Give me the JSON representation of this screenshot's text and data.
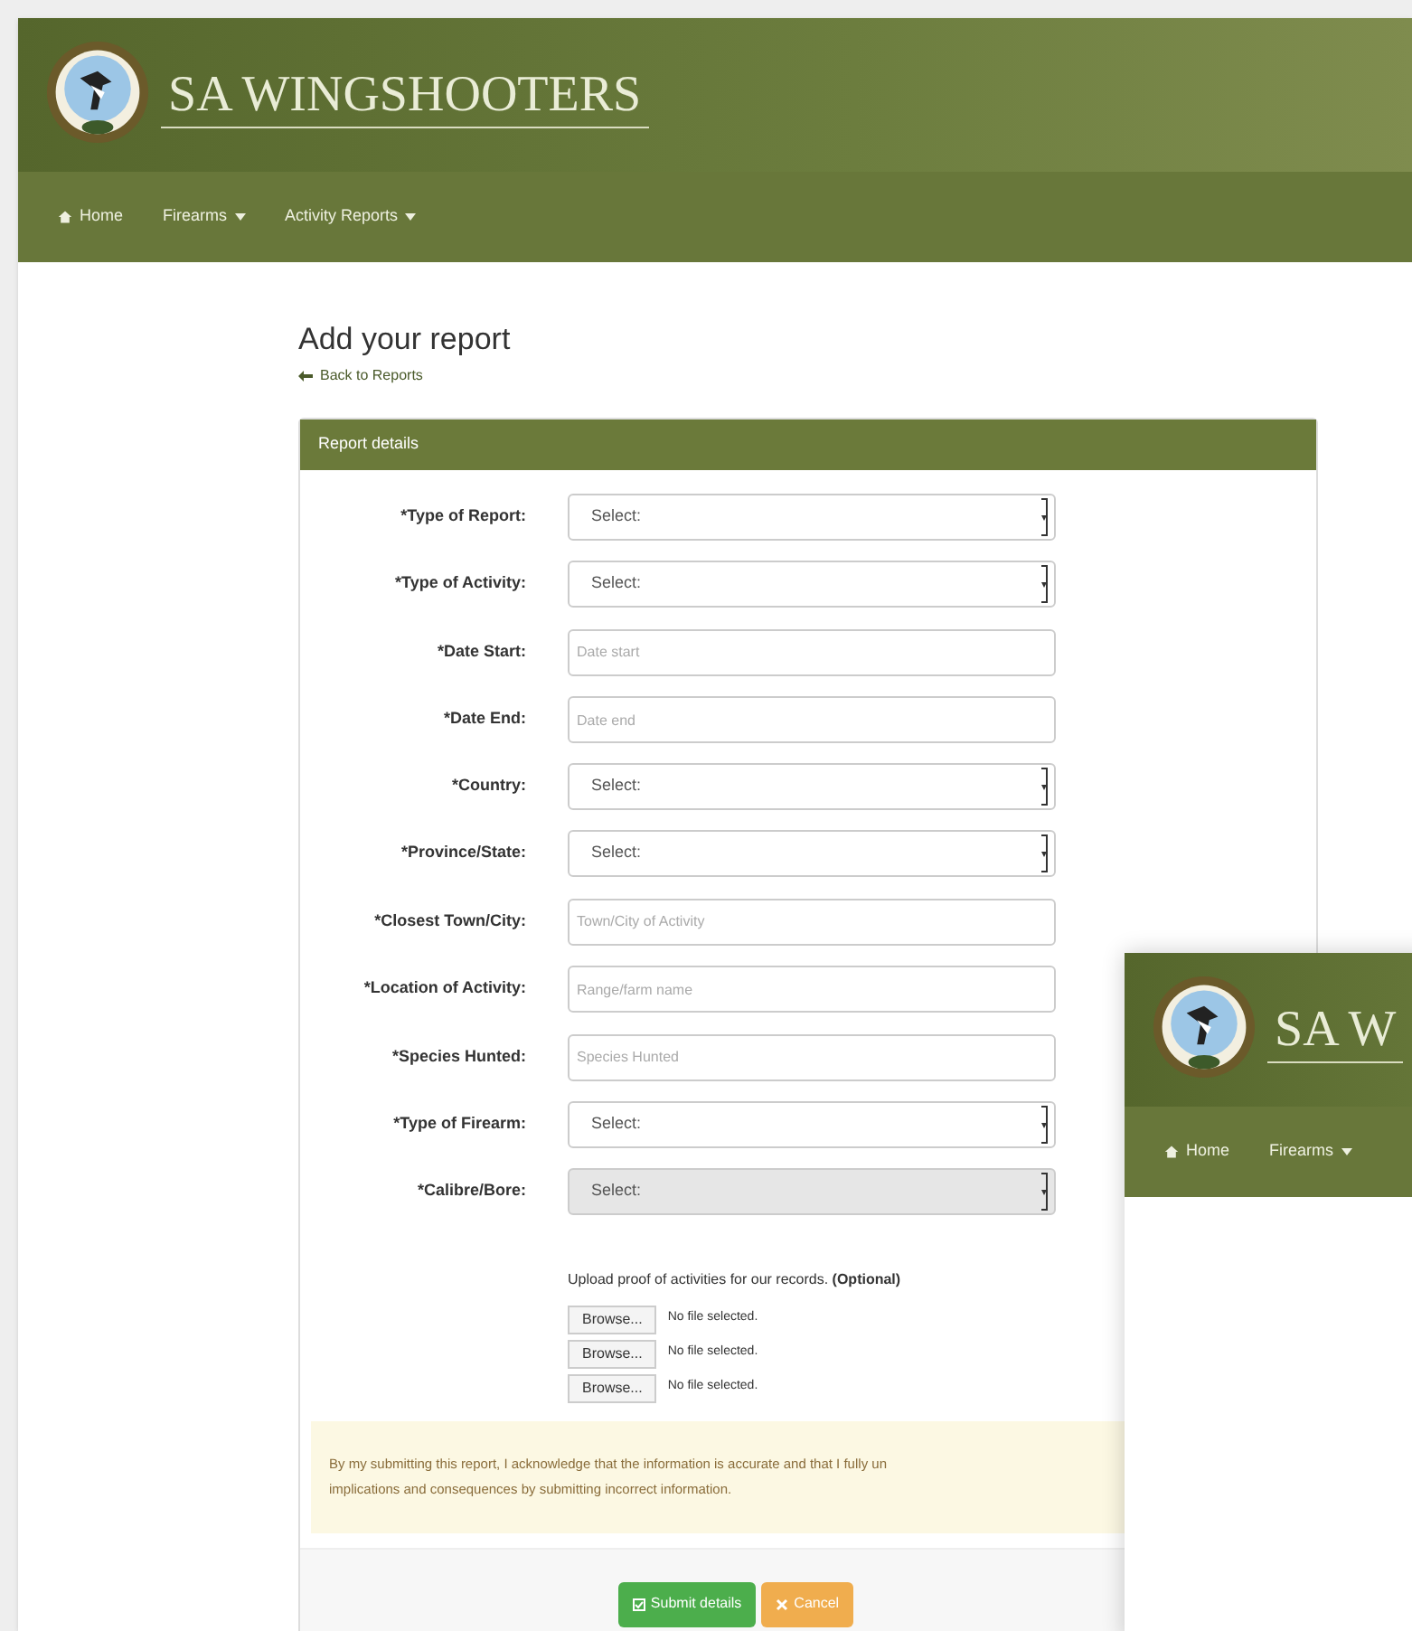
{
  "site": {
    "title": "SA WINGSHOOTERS"
  },
  "nav": [
    {
      "label": "Home",
      "kind": "home"
    },
    {
      "label": "Firearms",
      "kind": "dropdown"
    },
    {
      "label": "Activity Reports",
      "kind": "dropdown"
    }
  ],
  "page": {
    "title": "Add your report",
    "back_link": "Back to Reports"
  },
  "panel": {
    "title": "Report details",
    "fields": [
      {
        "label": "*Type of Report:",
        "kind": "select",
        "value": "Select:",
        "disabled": false
      },
      {
        "label": "*Type of Activity:",
        "kind": "select",
        "value": "Select:",
        "disabled": false
      },
      {
        "label": "*Date Start:",
        "kind": "text",
        "placeholder": "Date start",
        "disabled": false
      },
      {
        "label": "*Date End:",
        "kind": "text",
        "placeholder": "Date end",
        "disabled": false
      },
      {
        "label": "*Country:",
        "kind": "select",
        "value": "Select:",
        "disabled": false
      },
      {
        "label": "*Province/State:",
        "kind": "select",
        "value": "Select:",
        "disabled": false
      },
      {
        "label": "*Closest Town/City:",
        "kind": "text",
        "placeholder": "Town/City of Activity",
        "disabled": false
      },
      {
        "label": "*Location of Activity:",
        "kind": "text",
        "placeholder": "Range/farm name",
        "disabled": false
      },
      {
        "label": "*Species Hunted:",
        "kind": "text",
        "placeholder": "Species Hunted",
        "disabled": false
      },
      {
        "label": "*Type of Firearm:",
        "kind": "select",
        "value": "Select:",
        "disabled": false
      },
      {
        "label": "*Calibre/Bore:",
        "kind": "select",
        "value": "Select:",
        "disabled": true
      }
    ],
    "upload": {
      "text": "Upload proof of activities for our records. **(Optional)**",
      "files": [
        {
          "button": "Browse...",
          "status": "No file selected."
        },
        {
          "button": "Browse...",
          "status": "No file selected."
        },
        {
          "button": "Browse...",
          "status": "No file selected."
        }
      ]
    },
    "disclaimer": [
      "By my submitting this report, I acknowledge that the information is accurate and that I fully un",
      "implications and consequences by submitting incorrect information."
    ],
    "buttons": [
      {
        "label": "Submit details",
        "kind": "submit"
      },
      {
        "label": "Cancel",
        "kind": "cancel"
      }
    ]
  },
  "second_window": {
    "title": "SA W",
    "nav": [
      {
        "label": "Home",
        "kind": "home"
      },
      {
        "label": "Firearms",
        "kind": "dropdown"
      }
    ]
  }
}
